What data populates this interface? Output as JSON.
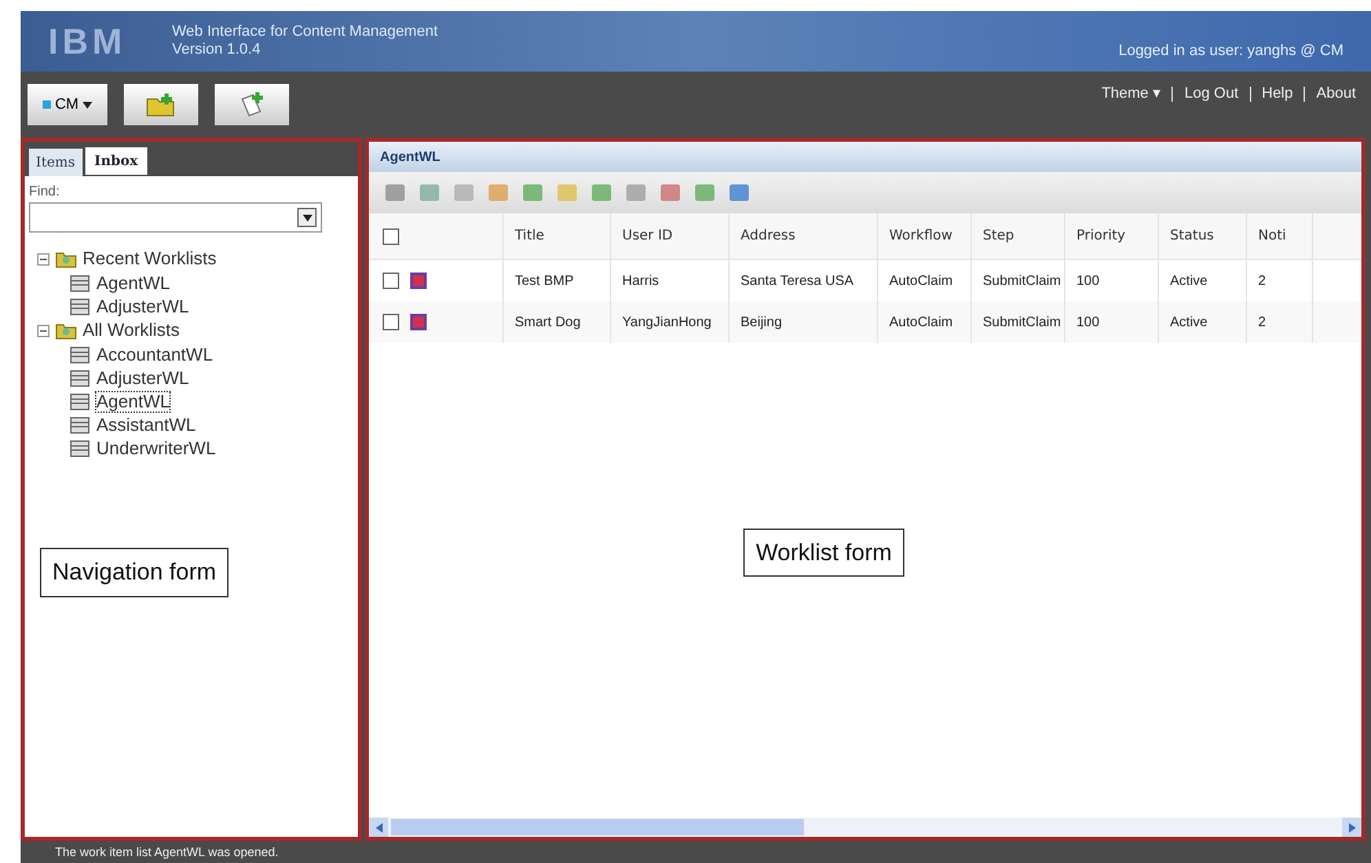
{
  "header": {
    "logo": "IBM",
    "title": "Web Interface for Content Management",
    "version": "Version 1.0.4",
    "user": "Logged in as user: yanghs @ CM"
  },
  "toolbar": {
    "repository": "CM",
    "links": [
      "Theme ▾",
      "Log Out",
      "Help",
      "About"
    ]
  },
  "nav": {
    "tabs": [
      {
        "label": "Items",
        "selected": false
      },
      {
        "label": "Inbox",
        "selected": true
      }
    ],
    "find": {
      "label": "Find:"
    },
    "tree": [
      {
        "label": "Recent Worklists",
        "expanded": true,
        "children": [
          {
            "label": "AgentWL",
            "selected": false
          },
          {
            "label": "AdjusterWL",
            "selected": false
          }
        ]
      },
      {
        "label": "All Worklists",
        "expanded": true,
        "children": [
          {
            "label": "AccountantWL",
            "selected": false
          },
          {
            "label": "AdjusterWL",
            "selected": false
          },
          {
            "label": "AgentWL",
            "selected": true
          },
          {
            "label": "AssistantWL",
            "selected": false
          },
          {
            "label": "UnderwriterWL",
            "selected": false
          }
        ]
      }
    ],
    "annotation": "Navigation form"
  },
  "worklist": {
    "title": "AgentWL",
    "select_all": {
      "checked": false
    },
    "columns": [
      "Title",
      "User ID",
      "Address",
      "Workflow",
      "Step",
      "Priority",
      "Status",
      "Noti"
    ],
    "rows": [
      {
        "checked": false,
        "cells": [
          "Test BMP",
          "Harris",
          "Santa Teresa USA",
          "AutoClaim",
          "SubmitClaim",
          "100",
          "Active",
          "2"
        ]
      },
      {
        "checked": false,
        "cells": [
          "Smart Dog",
          "YangJianHong",
          "Beijing",
          "AutoClaim",
          "SubmitClaim",
          "100",
          "Active",
          "2"
        ]
      }
    ],
    "annotation": "Worklist form"
  },
  "status_bar": "The work item list AgentWL was opened."
}
